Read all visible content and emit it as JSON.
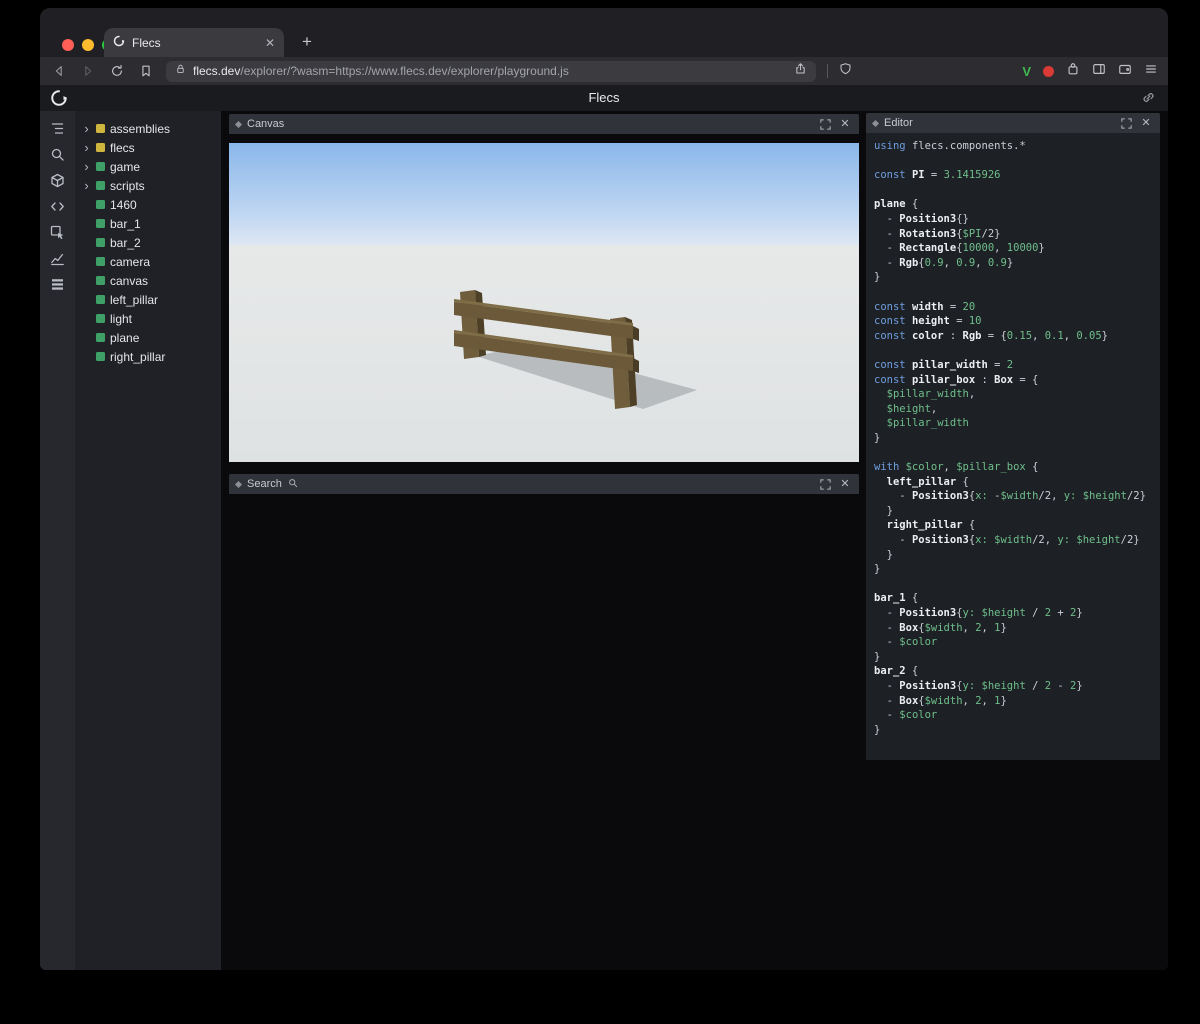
{
  "browser": {
    "tab_title": "Flecs",
    "url_domain": "flecs.dev",
    "url_path": "/explorer/?wasm=https://www.flecs.dev/explorer/playground.js",
    "extension_badge": "V"
  },
  "app": {
    "title": "Flecs"
  },
  "sidebar": {
    "icons": [
      "entity-tree-icon",
      "search-icon",
      "entities-icon",
      "code-icon",
      "inspect-icon",
      "stats-icon",
      "queries-icon"
    ]
  },
  "tree": {
    "items": [
      {
        "label": "assemblies",
        "color": "#cdb53e",
        "expandable": true
      },
      {
        "label": "flecs",
        "color": "#cdb53e",
        "expandable": true
      },
      {
        "label": "game",
        "color": "#3fa067",
        "expandable": true
      },
      {
        "label": "scripts",
        "color": "#3fa067",
        "expandable": true
      },
      {
        "label": "1460",
        "color": "#3fa067",
        "expandable": false
      },
      {
        "label": "bar_1",
        "color": "#3fa067",
        "expandable": false
      },
      {
        "label": "bar_2",
        "color": "#3fa067",
        "expandable": false
      },
      {
        "label": "camera",
        "color": "#3fa067",
        "expandable": false
      },
      {
        "label": "canvas",
        "color": "#3fa067",
        "expandable": false
      },
      {
        "label": "left_pillar",
        "color": "#3fa067",
        "expandable": false
      },
      {
        "label": "light",
        "color": "#3fa067",
        "expandable": false
      },
      {
        "label": "plane",
        "color": "#3fa067",
        "expandable": false
      },
      {
        "label": "right_pillar",
        "color": "#3fa067",
        "expandable": false
      }
    ]
  },
  "panels": {
    "canvas_title": "Canvas",
    "search_title": "Search",
    "editor_title": "Editor"
  },
  "scene": {
    "sky_color": "#8ab7ea",
    "ground_color": "#e1e4e5",
    "fence_wood_color": "#6f5d3c"
  },
  "editor": {
    "lines": [
      [
        [
          "k",
          "using "
        ],
        [
          "p",
          "flecs.components.*"
        ]
      ],
      [],
      [
        [
          "k",
          "const "
        ],
        [
          "b",
          "PI"
        ],
        [
          "p",
          " = "
        ],
        [
          "g",
          "3.1415926"
        ]
      ],
      [],
      [
        [
          "b",
          "plane"
        ],
        [
          "p",
          " {"
        ]
      ],
      [
        [
          "p",
          "  - "
        ],
        [
          "b",
          "Position3"
        ],
        [
          "p",
          "{}"
        ]
      ],
      [
        [
          "p",
          "  - "
        ],
        [
          "b",
          "Rotation3"
        ],
        [
          "p",
          "{"
        ],
        [
          "g",
          "$PI"
        ],
        [
          "p",
          "/2}"
        ]
      ],
      [
        [
          "p",
          "  - "
        ],
        [
          "b",
          "Rectangle"
        ],
        [
          "p",
          "{"
        ],
        [
          "g",
          "10000"
        ],
        [
          "p",
          ", "
        ],
        [
          "g",
          "10000"
        ],
        [
          "p",
          "}"
        ]
      ],
      [
        [
          "p",
          "  - "
        ],
        [
          "b",
          "Rgb"
        ],
        [
          "p",
          "{"
        ],
        [
          "g",
          "0.9"
        ],
        [
          "p",
          ", "
        ],
        [
          "g",
          "0.9"
        ],
        [
          "p",
          ", "
        ],
        [
          "g",
          "0.9"
        ],
        [
          "p",
          "}"
        ]
      ],
      [
        [
          "p",
          "}"
        ]
      ],
      [],
      [
        [
          "k",
          "const "
        ],
        [
          "b",
          "width"
        ],
        [
          "p",
          " = "
        ],
        [
          "g",
          "20"
        ]
      ],
      [
        [
          "k",
          "const "
        ],
        [
          "b",
          "height"
        ],
        [
          "p",
          " = "
        ],
        [
          "g",
          "10"
        ]
      ],
      [
        [
          "k",
          "const "
        ],
        [
          "b",
          "color"
        ],
        [
          "p",
          " : "
        ],
        [
          "b",
          "Rgb"
        ],
        [
          "p",
          " = {"
        ],
        [
          "g",
          "0.15"
        ],
        [
          "p",
          ", "
        ],
        [
          "g",
          "0.1"
        ],
        [
          "p",
          ", "
        ],
        [
          "g",
          "0.05"
        ],
        [
          "p",
          "}"
        ]
      ],
      [],
      [
        [
          "k",
          "const "
        ],
        [
          "b",
          "pillar_width"
        ],
        [
          "p",
          " = "
        ],
        [
          "g",
          "2"
        ]
      ],
      [
        [
          "k",
          "const "
        ],
        [
          "b",
          "pillar_box"
        ],
        [
          "p",
          " : "
        ],
        [
          "b",
          "Box"
        ],
        [
          "p",
          " = {"
        ]
      ],
      [
        [
          "p",
          "  "
        ],
        [
          "g",
          "$pillar_width"
        ],
        [
          "p",
          ","
        ]
      ],
      [
        [
          "p",
          "  "
        ],
        [
          "g",
          "$height"
        ],
        [
          "p",
          ","
        ]
      ],
      [
        [
          "p",
          "  "
        ],
        [
          "g",
          "$pillar_width"
        ]
      ],
      [
        [
          "p",
          "}"
        ]
      ],
      [],
      [
        [
          "k",
          "with "
        ],
        [
          "g",
          "$color"
        ],
        [
          "p",
          ", "
        ],
        [
          "g",
          "$pillar_box"
        ],
        [
          "p",
          " {"
        ]
      ],
      [
        [
          "p",
          "  "
        ],
        [
          "b",
          "left_pillar"
        ],
        [
          "p",
          " {"
        ]
      ],
      [
        [
          "p",
          "    - "
        ],
        [
          "b",
          "Position3"
        ],
        [
          "p",
          "{"
        ],
        [
          "g",
          "x:"
        ],
        [
          "p",
          " -"
        ],
        [
          "g",
          "$width"
        ],
        [
          "p",
          "/2, "
        ],
        [
          "g",
          "y:"
        ],
        [
          "p",
          " "
        ],
        [
          "g",
          "$height"
        ],
        [
          "p",
          "/2}"
        ]
      ],
      [
        [
          "p",
          "  }"
        ]
      ],
      [
        [
          "p",
          "  "
        ],
        [
          "b",
          "right_pillar"
        ],
        [
          "p",
          " {"
        ]
      ],
      [
        [
          "p",
          "    - "
        ],
        [
          "b",
          "Position3"
        ],
        [
          "p",
          "{"
        ],
        [
          "g",
          "x:"
        ],
        [
          "p",
          " "
        ],
        [
          "g",
          "$width"
        ],
        [
          "p",
          "/2, "
        ],
        [
          "g",
          "y:"
        ],
        [
          "p",
          " "
        ],
        [
          "g",
          "$height"
        ],
        [
          "p",
          "/2}"
        ]
      ],
      [
        [
          "p",
          "  }"
        ]
      ],
      [
        [
          "p",
          "}"
        ]
      ],
      [],
      [
        [
          "b",
          "bar_1"
        ],
        [
          "p",
          " {"
        ]
      ],
      [
        [
          "p",
          "  - "
        ],
        [
          "b",
          "Position3"
        ],
        [
          "p",
          "{"
        ],
        [
          "g",
          "y:"
        ],
        [
          "p",
          " "
        ],
        [
          "g",
          "$height"
        ],
        [
          "p",
          " / "
        ],
        [
          "g",
          "2"
        ],
        [
          "p",
          " + "
        ],
        [
          "g",
          "2"
        ],
        [
          "p",
          "}"
        ]
      ],
      [
        [
          "p",
          "  - "
        ],
        [
          "b",
          "Box"
        ],
        [
          "p",
          "{"
        ],
        [
          "g",
          "$width"
        ],
        [
          "p",
          ", "
        ],
        [
          "g",
          "2"
        ],
        [
          "p",
          ", "
        ],
        [
          "g",
          "1"
        ],
        [
          "p",
          "}"
        ]
      ],
      [
        [
          "p",
          "  - "
        ],
        [
          "g",
          "$color"
        ]
      ],
      [
        [
          "p",
          "}"
        ]
      ],
      [
        [
          "b",
          "bar_2"
        ],
        [
          "p",
          " {"
        ]
      ],
      [
        [
          "p",
          "  - "
        ],
        [
          "b",
          "Position3"
        ],
        [
          "p",
          "{"
        ],
        [
          "g",
          "y:"
        ],
        [
          "p",
          " "
        ],
        [
          "g",
          "$height"
        ],
        [
          "p",
          " / "
        ],
        [
          "g",
          "2"
        ],
        [
          "p",
          " - "
        ],
        [
          "g",
          "2"
        ],
        [
          "p",
          "}"
        ]
      ],
      [
        [
          "p",
          "  - "
        ],
        [
          "b",
          "Box"
        ],
        [
          "p",
          "{"
        ],
        [
          "g",
          "$width"
        ],
        [
          "p",
          ", "
        ],
        [
          "g",
          "2"
        ],
        [
          "p",
          ", "
        ],
        [
          "g",
          "1"
        ],
        [
          "p",
          "}"
        ]
      ],
      [
        [
          "p",
          "  - "
        ],
        [
          "g",
          "$color"
        ]
      ],
      [
        [
          "p",
          "}"
        ]
      ]
    ]
  }
}
